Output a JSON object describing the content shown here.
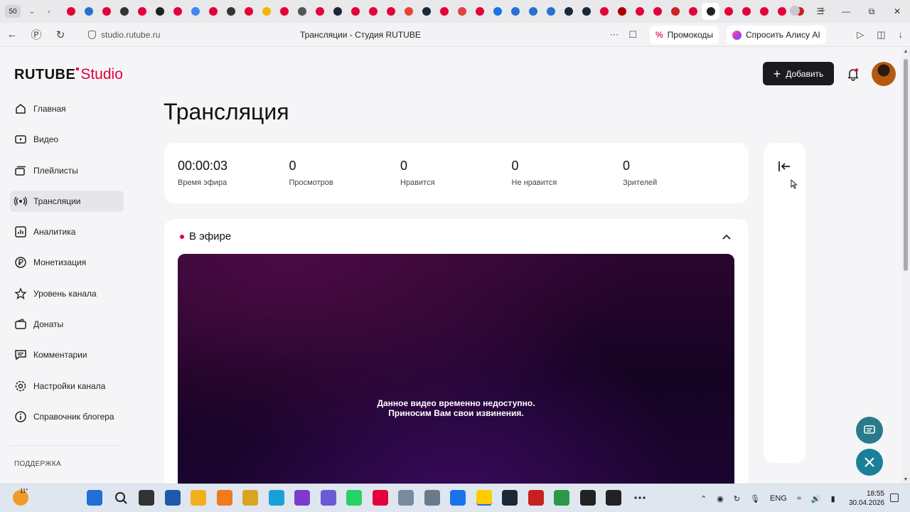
{
  "browser": {
    "tab_count": "50",
    "tab_favicons": [
      "#e3003c",
      "#2a6fd6",
      "#e3003c",
      "#333",
      "#e3003c",
      "#222",
      "#e3003c",
      "#4285f4",
      "#e3003c",
      "#333",
      "#e3003c",
      "#f6b400",
      "#e3003c",
      "#555",
      "#e3003c",
      "#1b2838",
      "#e3003c",
      "#e3003c",
      "#e3003c",
      "#ea4335",
      "#1b2838",
      "#e3003c",
      "#d44",
      "#e3003c",
      "#1a73e8",
      "#2a6fd6",
      "#2a6fd6",
      "#2a6fd6",
      "#1b2838",
      "#1b2838",
      "#e3003c",
      "#a00",
      "#e3003c",
      "#e3003c",
      "#c22",
      "#e3003c",
      "#222",
      "#e3003c",
      "#e3003c",
      "#e3003c",
      "#e3003c",
      "#c22"
    ],
    "url": "studio.rutube.ru",
    "page_title": "Трансляции - Студия RUTUBE",
    "promo_label": "Промокоды",
    "alice_label": "Спросить Алису AI"
  },
  "header": {
    "logo_text": "RUTUBE",
    "logo_studio": "Studio",
    "add_button_label": "Добавить"
  },
  "sidebar": {
    "items": [
      {
        "label": "Главная",
        "icon": "home-icon"
      },
      {
        "label": "Видео",
        "icon": "video-icon"
      },
      {
        "label": "Плейлисты",
        "icon": "playlist-icon"
      },
      {
        "label": "Трансляции",
        "icon": "broadcast-icon",
        "active": true
      },
      {
        "label": "Аналитика",
        "icon": "analytics-icon"
      },
      {
        "label": "Монетизация",
        "icon": "monetization-icon"
      },
      {
        "label": "Уровень канала",
        "icon": "star-icon"
      },
      {
        "label": "Донаты",
        "icon": "donate-icon"
      },
      {
        "label": "Комментарии",
        "icon": "comments-icon"
      },
      {
        "label": "Настройки канала",
        "icon": "settings-icon"
      },
      {
        "label": "Справочник блогера",
        "icon": "info-icon"
      }
    ],
    "support_label": "ПОДДЕРЖКА"
  },
  "main": {
    "title": "Трансляция",
    "stats": [
      {
        "value": "00:00:03",
        "label": "Время эфира"
      },
      {
        "value": "0",
        "label": "Просмотров"
      },
      {
        "value": "0",
        "label": "Нравится"
      },
      {
        "value": "0",
        "label": "Не нравится"
      },
      {
        "value": "0",
        "label": "Зрителей"
      }
    ],
    "live_label": "В эфире",
    "player_message_line1": "Данное видео временно недоступно.",
    "player_message_line2": "Приносим Вам свои извинения."
  },
  "taskbar": {
    "weather_temp": "11°",
    "language": "ENG",
    "time": "18:55",
    "date": "30.04.2026"
  },
  "colors": {
    "accent": "#e3003c",
    "dark_button": "#1b1b1f",
    "fab": "#1c7f98"
  }
}
